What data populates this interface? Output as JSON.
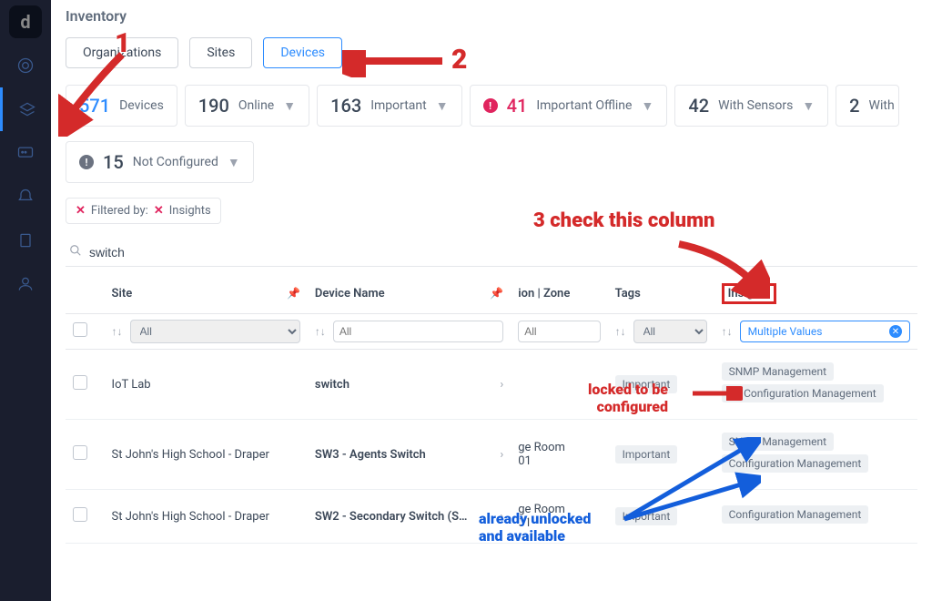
{
  "page": {
    "title": "Inventory"
  },
  "tabs": [
    {
      "label": "Organizations",
      "active": false
    },
    {
      "label": "Sites",
      "active": false
    },
    {
      "label": "Devices",
      "active": true
    }
  ],
  "stats": {
    "devices": {
      "num": "571",
      "label": "Devices"
    },
    "online": {
      "num": "190",
      "label": "Online"
    },
    "important": {
      "num": "163",
      "label": "Important"
    },
    "important_offline": {
      "num": "41",
      "label": "Important Offline"
    },
    "with_sensors": {
      "num": "42",
      "label": "With Sensors"
    },
    "with_cut": {
      "num": "2",
      "label": "With"
    },
    "not_configured": {
      "num": "15",
      "label": "Not Configured"
    }
  },
  "filter_bar": {
    "label": "Filtered by:",
    "chip": "Insights"
  },
  "search": {
    "value": "switch"
  },
  "columns": {
    "site": "Site",
    "device": "Device Name",
    "zone": "ion | Zone",
    "tags": "Tags",
    "insights": "Insights"
  },
  "col_filters": {
    "all": "All",
    "multiple_values": "Multiple Values"
  },
  "rows": [
    {
      "site": "IoT Lab",
      "device": "switch",
      "zone": "",
      "tags": [
        "Important"
      ],
      "insights": [
        {
          "label": "SNMP Management",
          "locked": false
        },
        {
          "label": "Configuration Management",
          "locked": true
        }
      ]
    },
    {
      "site": "St John's High School - Draper",
      "device": "SW3 - Agents Switch",
      "zone_l1": "ge Room",
      "zone_l2": "01",
      "tags": [
        "Important"
      ],
      "insights": [
        {
          "label": "SNMP Management",
          "locked": false
        },
        {
          "label": "Configuration Management",
          "locked": false
        }
      ]
    },
    {
      "site": "St John's High School - Draper",
      "device": "SW2 - Secondary Switch (S…",
      "zone_l1": "ge Room",
      "zone_l2": "01",
      "tags": [
        "Important"
      ],
      "insights": [
        {
          "label": "Configuration Management",
          "locked": false
        }
      ]
    }
  ],
  "annotations": {
    "n1": "1",
    "n2": "2",
    "n3": "3 check this column",
    "locked": "locked to be\nconfigured",
    "unlocked": "already unlocked\nand available"
  }
}
